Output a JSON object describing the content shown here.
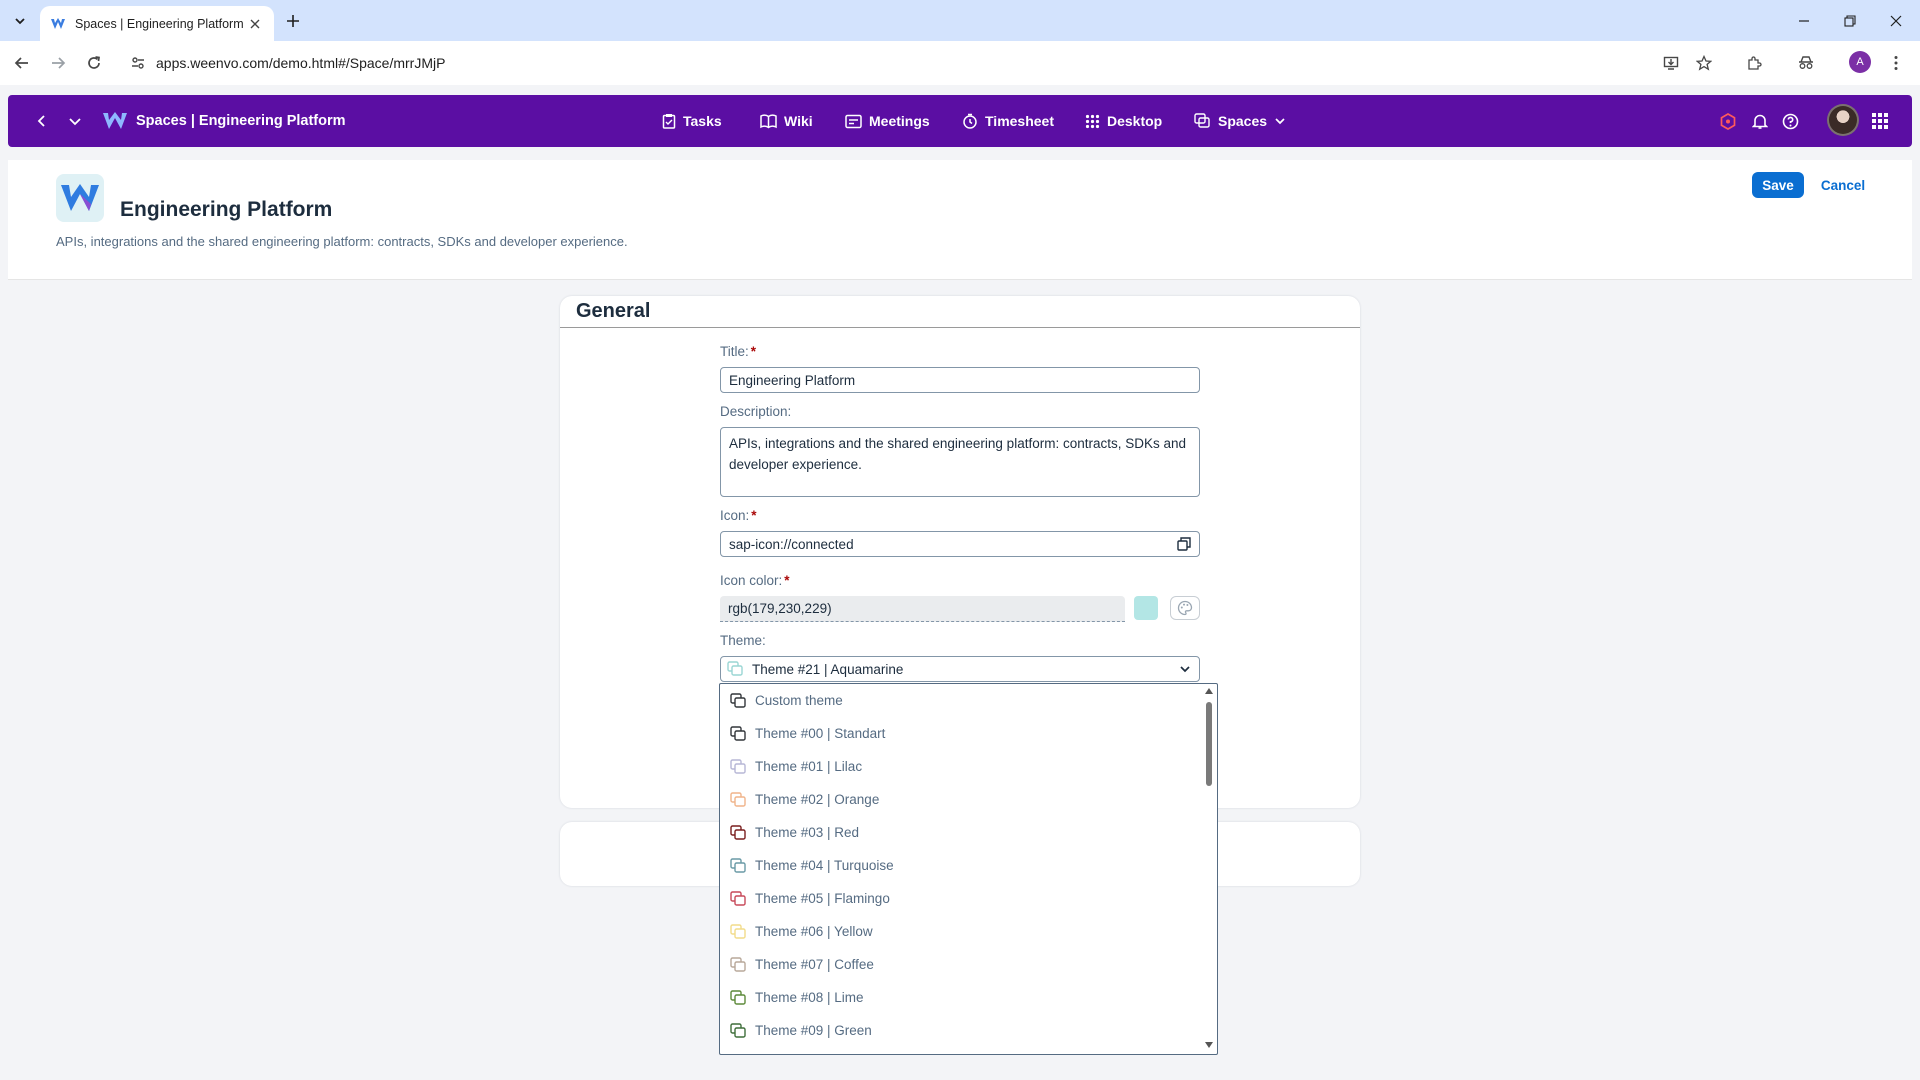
{
  "browser": {
    "tab_title": "Spaces | Engineering Platform",
    "url": "apps.weenvo.com/demo.html#/Space/mrrJMjP",
    "profile_initial": "A"
  },
  "shellbar": {
    "title": "Spaces | Engineering Platform",
    "nav": [
      {
        "label": "Tasks",
        "icon": "clipboard-icon"
      },
      {
        "label": "Wiki",
        "icon": "book-icon"
      },
      {
        "label": "Meetings",
        "icon": "meetings-icon"
      },
      {
        "label": "Timesheet",
        "icon": "timesheet-icon"
      },
      {
        "label": "Desktop",
        "icon": "grid-icon"
      },
      {
        "label": "Spaces",
        "icon": "spaces-icon"
      }
    ]
  },
  "header": {
    "title": "Engineering Platform",
    "description": "APIs, integrations and the shared engineering platform: contracts, SDKs and developer experience.",
    "save_label": "Save",
    "cancel_label": "Cancel"
  },
  "form": {
    "section_title": "General",
    "title_label": "Title:",
    "title_value": "Engineering Platform",
    "description_label": "Description:",
    "description_value": "APIs, integrations and the shared engineering platform: contracts, SDKs and developer experience.",
    "icon_label": "Icon:",
    "icon_value": "sap-icon://connected",
    "icon_color_label": "Icon color:",
    "icon_color_value": "rgb(179,230,229)",
    "icon_color_swatch": "#b3e6e5",
    "theme_label": "Theme:",
    "theme_value": "Theme #21 | Aquamarine",
    "required_mark": "*"
  },
  "theme_options": [
    {
      "label": "Custom theme",
      "color": "#32363a"
    },
    {
      "label": "Theme #00 | Standart",
      "color": "#32363a"
    },
    {
      "label": "Theme #01 | Lilac",
      "color": "#b7b7d6"
    },
    {
      "label": "Theme #02 | Orange",
      "color": "#f0b48a"
    },
    {
      "label": "Theme #03 | Red",
      "color": "#7a1f1f"
    },
    {
      "label": "Theme #04 | Turquoise",
      "color": "#6a9aa6"
    },
    {
      "label": "Theme #05 | Flamingo",
      "color": "#c74a5a"
    },
    {
      "label": "Theme #06 | Yellow",
      "color": "#f2dc8a"
    },
    {
      "label": "Theme #07 | Coffee",
      "color": "#b8a89a"
    },
    {
      "label": "Theme #08 | Lime",
      "color": "#5d8a3a"
    },
    {
      "label": "Theme #09 | Green",
      "color": "#3f6e3a"
    }
  ]
}
